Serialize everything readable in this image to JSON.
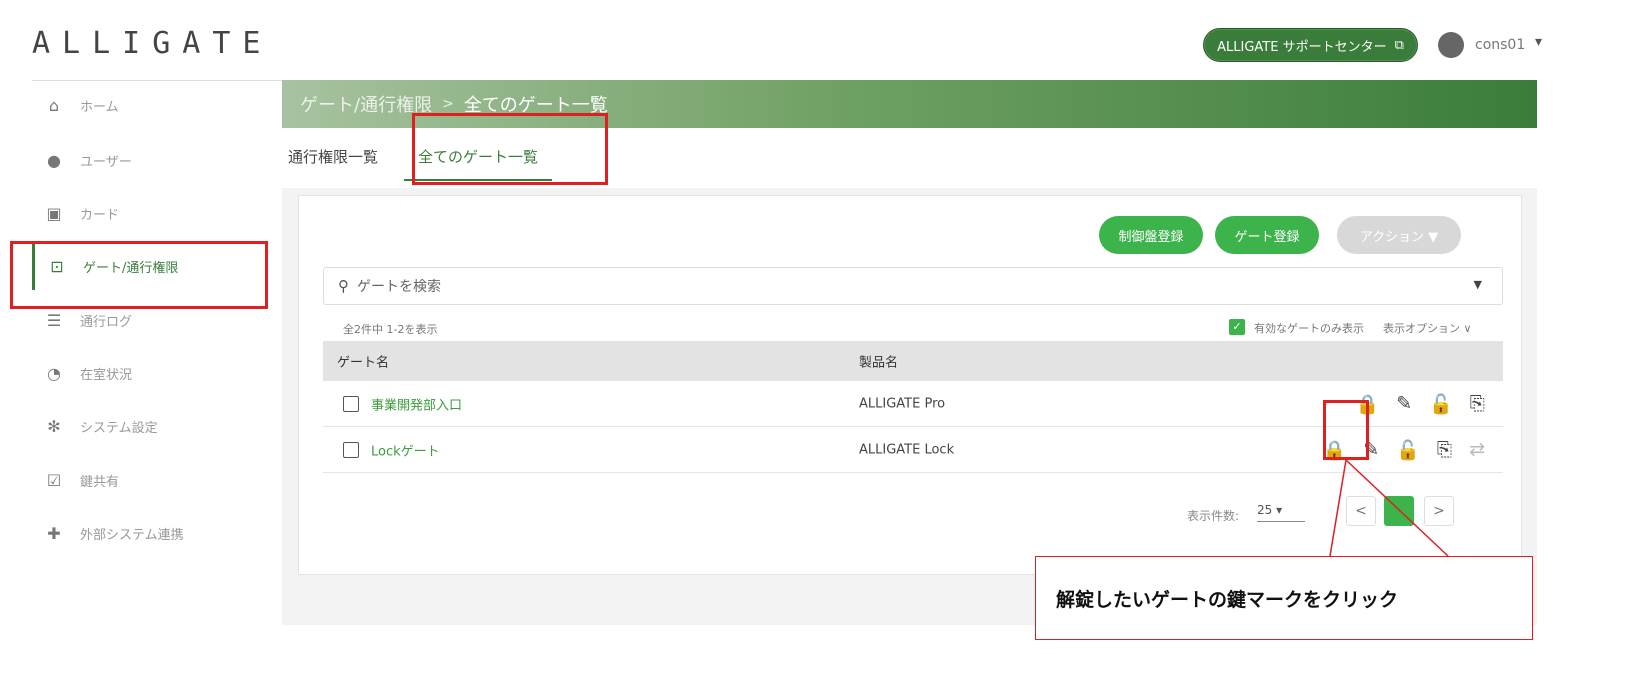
{
  "header": {
    "logo": "ALLIGATE",
    "support_button": "ALLIGATE サポートセンター",
    "support_icon": "external-link-icon",
    "user_name": "cons01",
    "user_chevron": "▾"
  },
  "sidebar": {
    "items": [
      {
        "label": "ホーム",
        "icon": "⌂"
      },
      {
        "label": "ユーザー",
        "icon": "●"
      },
      {
        "label": "カード",
        "icon": "▣"
      },
      {
        "label": "ゲート/通行権限",
        "icon": "⊡"
      },
      {
        "label": "通行ログ",
        "icon": "☰"
      },
      {
        "label": "在室状況",
        "icon": "◔"
      },
      {
        "label": "システム設定",
        "icon": "✻"
      },
      {
        "label": "鍵共有",
        "icon": "☑"
      },
      {
        "label": "外部システム連携",
        "icon": "✚"
      }
    ]
  },
  "breadcrumb": {
    "parent": "ゲート/通行権限",
    "separator": ">",
    "current": "全てのゲート一覧"
  },
  "tabs": {
    "tab1": "通行権限一覧",
    "tab2": "全てのゲート一覧"
  },
  "toolbar": {
    "register_panel": "制御盤登録",
    "register_gate": "ゲート登録",
    "actions": "アクション ▼"
  },
  "search": {
    "placeholder": "ゲートを検索",
    "dropdown": "▼"
  },
  "list_meta": {
    "count": "全2件中 1-2を表示",
    "only_valid": "有効なゲートのみ表示",
    "display_options": "表示オプション ∨"
  },
  "table": {
    "headers": {
      "name": "ゲート名",
      "product": "製品名"
    },
    "rows": [
      {
        "name": "事業開発部入口",
        "product": "ALLIGATE Pro"
      },
      {
        "name": "Lockゲート",
        "product": "ALLIGATE Lock"
      }
    ]
  },
  "pagination": {
    "per_page_label": "表示件数:",
    "per_page_value": "25",
    "prev": "<",
    "next": ">"
  },
  "callout": {
    "text": "解錠したいゲートの鍵マークをクリック"
  },
  "colors": {
    "brand_green": "#3a7d3a",
    "button_green": "#3cb44b",
    "highlight_red": "#e02020"
  }
}
